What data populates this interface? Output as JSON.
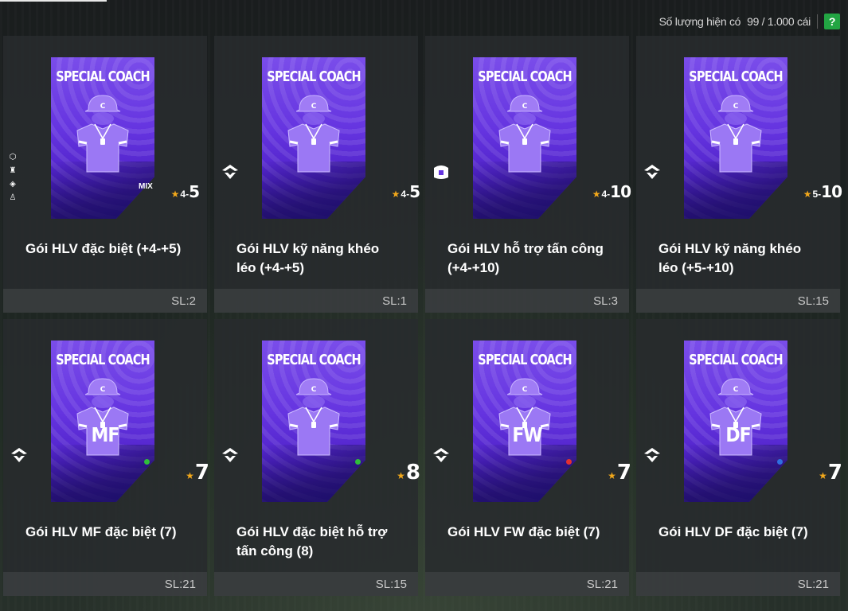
{
  "header": {
    "capacity_label": "Số lượng hiện có",
    "capacity_value": "99 / 1.000 cái",
    "help_label": "?"
  },
  "colors": {
    "accent_green": "#22a543",
    "card_purple": "#6534e0",
    "star_gold": "#f2a81b"
  },
  "items": [
    {
      "card_title": "SPECIAL COACH",
      "name": "Gói HLV đặc biệt (+4-+5)",
      "qty": "SL:2",
      "level_from": "4",
      "level_to": "5",
      "mix": "MIX",
      "icon": "skill-icons-stack",
      "position": "",
      "dot_color": ""
    },
    {
      "card_title": "SPECIAL COACH",
      "name": "Gói HLV kỹ năng khéo léo (+4-+5)",
      "qty": "SL:1",
      "level_from": "4",
      "level_to": "5",
      "mix": "",
      "icon": "dribble-skill-icon",
      "position": "",
      "dot_color": ""
    },
    {
      "card_title": "SPECIAL COACH",
      "name": "Gói HLV hỗ trợ tấn công (+4-+10)",
      "qty": "SL:3",
      "level_from": "4",
      "level_to": "10",
      "mix": "",
      "icon": "attack-support-icon",
      "position": "",
      "dot_color": ""
    },
    {
      "card_title": "SPECIAL COACH",
      "name": "Gói HLV kỹ năng khéo léo (+5-+10)",
      "qty": "SL:15",
      "level_from": "5",
      "level_to": "10",
      "mix": "",
      "icon": "dribble-skill-icon",
      "position": "",
      "dot_color": ""
    },
    {
      "card_title": "SPECIAL COACH",
      "name": "Gói HLV MF đặc biệt (7)",
      "qty": "SL:21",
      "level_from": "",
      "level_to": "7",
      "mix": "",
      "icon": "dribble-skill-icon",
      "position": "MF",
      "dot_color": "#2fbf3a"
    },
    {
      "card_title": "SPECIAL COACH",
      "name": "Gói HLV đặc biệt hỗ trợ tấn công (8)",
      "qty": "SL:15",
      "level_from": "",
      "level_to": "8",
      "mix": "",
      "icon": "dribble-skill-icon",
      "position": "",
      "dot_color": "#2fbf3a"
    },
    {
      "card_title": "SPECIAL COACH",
      "name": "Gói HLV FW đặc biệt (7)",
      "qty": "SL:21",
      "level_from": "",
      "level_to": "7",
      "mix": "",
      "icon": "dribble-skill-icon",
      "position": "FW",
      "dot_color": "#e53030"
    },
    {
      "card_title": "SPECIAL COACH",
      "name": "Gói HLV DF đặc biệt (7)",
      "qty": "SL:21",
      "level_from": "",
      "level_to": "7",
      "mix": "",
      "icon": "dribble-skill-icon",
      "position": "DF",
      "dot_color": "#2f6fe0"
    }
  ]
}
